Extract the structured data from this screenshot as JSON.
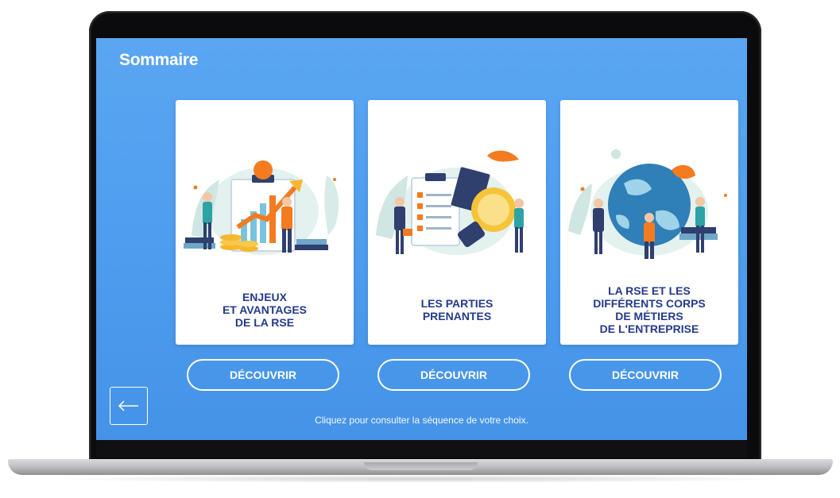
{
  "header": {
    "title": "Sommaire"
  },
  "cards": [
    {
      "title": "ENJEUX\nET AVANTAGES\nDE LA RSE",
      "button": "DÉCOUVRIR"
    },
    {
      "title": "LES PARTIES\nPRENANTES",
      "button": "DÉCOUVRIR"
    },
    {
      "title": "LA RSE ET LES\nDIFFÉRENTS CORPS\nDE MÉTIERS\nDE L'ENTREPRISE",
      "button": "DÉCOUVRIR"
    }
  ],
  "footer": {
    "hint": "Cliquez pour consulter la séquence de votre choix."
  },
  "nav": {
    "back_icon": "arrow-left-icon"
  },
  "colors": {
    "screen_bg": "#4d9cee",
    "card_title": "#243a8c",
    "accent_orange": "#f47b20",
    "accent_teal": "#5fb8b0",
    "accent_yellow": "#f5b82e"
  }
}
